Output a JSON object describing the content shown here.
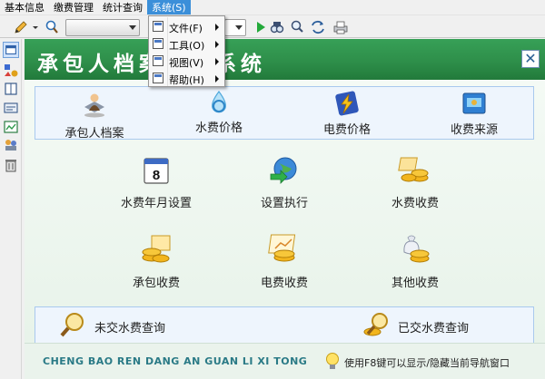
{
  "menubar": {
    "items": [
      {
        "label": "基本信息"
      },
      {
        "label": "缴费管理"
      },
      {
        "label": "统计查询"
      },
      {
        "label": "系统(S)"
      }
    ]
  },
  "dropdown": {
    "items": [
      {
        "label": "文件(F)"
      },
      {
        "label": "工具(O)"
      },
      {
        "label": "视图(V)"
      },
      {
        "label": "帮助(H)"
      }
    ]
  },
  "panel": {
    "title": "承包人档案管理系统",
    "close_label": "✕"
  },
  "top_group": [
    {
      "label": "承包人档案",
      "icon": "person-file-icon"
    },
    {
      "label": "水费价格",
      "icon": "water-drop-icon"
    },
    {
      "label": "电费价格",
      "icon": "lightning-icon"
    },
    {
      "label": "收费来源",
      "icon": "receipt-icon"
    }
  ],
  "middle_items": [
    {
      "label": "水费年月设置",
      "icon": "calendar-icon"
    },
    {
      "label": "设置执行",
      "icon": "globe-arrow-icon"
    },
    {
      "label": "水费收费",
      "icon": "coins-icon"
    },
    {
      "label": "承包收费",
      "icon": "coins-card-icon"
    },
    {
      "label": "电费收费",
      "icon": "coins-chart-icon"
    },
    {
      "label": "其他收费",
      "icon": "money-bag-icon"
    }
  ],
  "query_group": [
    {
      "label": "未交水费查询",
      "icon": "magnifier-icon"
    },
    {
      "label": "已交水费查询",
      "icon": "magnifier-coins-icon"
    }
  ],
  "footer": {
    "slogan": "CHENG BAO REN DANG AN GUAN LI XI TONG",
    "tip": "使用F8键可以显示/隐藏当前导航窗口"
  },
  "colors": {
    "header_green": "#2e8f4a",
    "menu_highlight": "#3b8fd9",
    "group_border": "#a9c9ee",
    "slogan": "#2a7a86"
  }
}
